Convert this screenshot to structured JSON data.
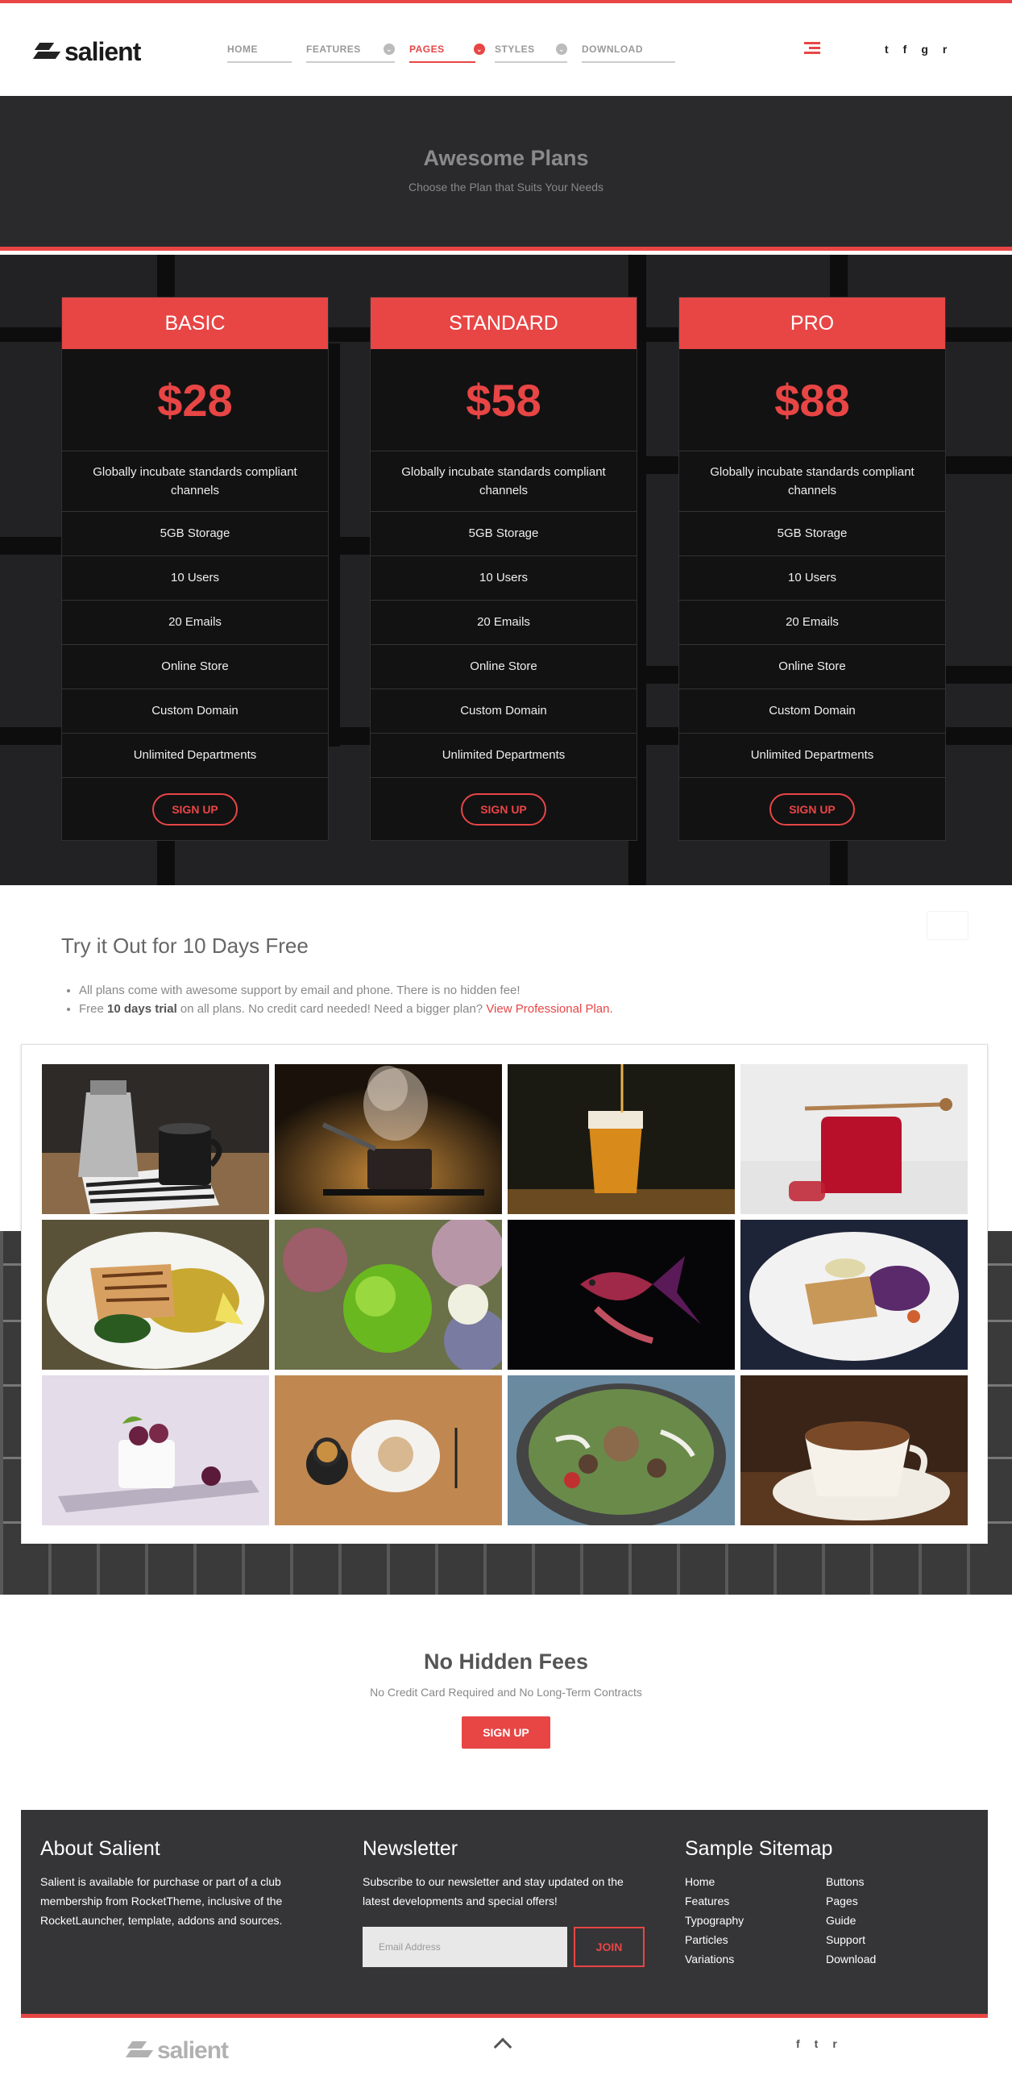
{
  "header": {
    "logo_text": "salient",
    "nav": [
      {
        "label": "HOME",
        "dropdown": false,
        "active": false
      },
      {
        "label": "FEATURES",
        "dropdown": true,
        "active": false
      },
      {
        "label": "PAGES",
        "dropdown": true,
        "active": true
      },
      {
        "label": "STYLES",
        "dropdown": true,
        "active": false
      },
      {
        "label": "DOWNLOAD",
        "dropdown": false,
        "active": false
      }
    ],
    "social": [
      "twitter-icon",
      "facebook-icon",
      "google-plus-icon",
      "rss-icon"
    ],
    "social_glyphs": [
      "t",
      "f",
      "g",
      "r"
    ]
  },
  "pricing": {
    "title": "Awesome Plans",
    "subtitle": "Choose the Plan that Suits Your Needs",
    "plans": [
      {
        "name": "BASIC",
        "price": "$28",
        "features": [
          "Globally incubate standards compliant channels",
          "5GB Storage",
          "10 Users",
          "20 Emails",
          "Online Store",
          "Custom Domain",
          "Unlimited Departments"
        ],
        "button": "SIGN UP"
      },
      {
        "name": "STANDARD",
        "price": "$58",
        "features": [
          "Globally incubate standards compliant channels",
          "5GB Storage",
          "10 Users",
          "20 Emails",
          "Online Store",
          "Custom Domain",
          "Unlimited Departments"
        ],
        "button": "SIGN UP"
      },
      {
        "name": "PRO",
        "price": "$88",
        "features": [
          "Globally incubate standards compliant channels",
          "5GB Storage",
          "10 Users",
          "20 Emails",
          "Online Store",
          "Custom Domain",
          "Unlimited Departments"
        ],
        "button": "SIGN UP"
      }
    ]
  },
  "trial": {
    "title": "Try it Out for 10 Days Free",
    "bullet1": "All plans come with awesome support by email and phone. There is no hidden fee!",
    "bullet2_pre": "Free ",
    "bullet2_bold": "10 days trial",
    "bullet2_mid": " on all plans. No credit card needed! Need a bigger plan? ",
    "bullet2_link": "View Professional Plan."
  },
  "gallery": [
    "coffee-moka-pot-image",
    "steaming-pot-image",
    "beer-glass-image",
    "honey-jar-image",
    "grilled-fish-plate-image",
    "green-flower-image",
    "fish-dark-image",
    "chicken-cabbage-plate-image",
    "panna-cotta-image",
    "tea-and-cookie-image",
    "mushroom-dish-image",
    "coffee-cup-image"
  ],
  "fees": {
    "title": "No Hidden Fees",
    "subtitle": "No Credit Card Required and No Long-Term Contracts",
    "button": "SIGN UP"
  },
  "footer": {
    "about_title": "About Salient",
    "about_text": "Salient is available for purchase or part of a club membership from RocketTheme, inclusive of the RocketLauncher, template, addons and sources.",
    "newsletter_title": "Newsletter",
    "newsletter_text": "Subscribe to our newsletter and stay updated on the latest developments and special offers!",
    "email_placeholder": "Email Address",
    "join_button": "JOIN",
    "sitemap_title": "Sample Sitemap",
    "sitemap_col1": [
      "Home",
      "Features",
      "Typography",
      "Particles",
      "Variations"
    ],
    "sitemap_col2": [
      "Buttons",
      "Pages",
      "Guide",
      "Support",
      "Download"
    ]
  },
  "bottom": {
    "logo_text": "salient",
    "social": [
      "facebook-icon",
      "twitter-icon",
      "rss-icon"
    ],
    "social_glyphs": [
      "f",
      "t",
      "r"
    ]
  },
  "colors": {
    "accent": "#e84545",
    "dark": "#222224",
    "footer": "#353537"
  }
}
